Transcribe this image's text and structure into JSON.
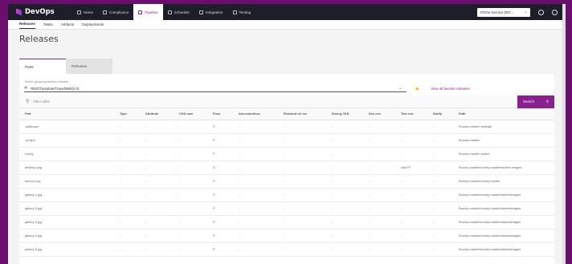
{
  "brand": {
    "name": "DevOps"
  },
  "topnav": {
    "tabs": [
      {
        "label": "Home",
        "active": false
      },
      {
        "label": "Compliance",
        "active": false
      },
      {
        "label": "Pipeline",
        "active": true
      },
      {
        "label": "Schedule",
        "active": false
      },
      {
        "label": "Integration",
        "active": false
      },
      {
        "label": "Testing",
        "active": false
      }
    ],
    "service_select": "POOe-Service (RO..."
  },
  "subnav": {
    "items": [
      {
        "label": "Releases",
        "active": true
      },
      {
        "label": "Tasks",
        "active": false
      },
      {
        "label": "Artifacts",
        "active": false
      },
      {
        "label": "Deployments",
        "active": false
      }
    ]
  },
  "page": {
    "title": "Releases"
  },
  "tabs": [
    {
      "label": "Parts",
      "active": true
    },
    {
      "label": "Releases",
      "active": false
    }
  ],
  "selector": {
    "label": "Select group/application/release",
    "value": "RDO/Translate/TravelWeb(2.0)",
    "view_all": "View all favorite releases"
  },
  "filter": {
    "placeholder": "Filter table",
    "search_label": "Search"
  },
  "table": {
    "columns": [
      "Part",
      "Type",
      "Attribute",
      "CKD user",
      "Envs",
      "Ancestor/desc",
      "Resident rel ver",
      "Emerg CKD",
      "Dev env",
      "Test env",
      "Notify",
      "Path"
    ],
    "rows": [
      [
        ".jsdtscope",
        "-",
        "-",
        "-",
        "P",
        "-",
        "-",
        "-",
        "-",
        "-",
        "-",
        "Bounty-master/.settings"
      ],
      [
        ".project",
        "-",
        "-",
        "-",
        "P",
        "-",
        "-",
        "-",
        "-",
        "-",
        "-",
        "Bounty-master/"
      ],
      [
        "config",
        "-",
        "-",
        "-",
        "P",
        "-",
        "-",
        "-",
        "-",
        "-",
        "-",
        "Bounty-master/.stdlive"
      ],
      [
        "desktop.png",
        "-",
        "-",
        "-",
        "D",
        "-",
        "-",
        "-",
        "-",
        "AN0YF",
        "-",
        "Bounty-master/bounty-master/seoline-images"
      ],
      [
        "favicon.svg",
        "-",
        "-",
        "-",
        "P",
        "-",
        "-",
        "-",
        "-",
        "-",
        "-",
        "Bounty-master/bounty-master"
      ],
      [
        "gallery-1.jpg",
        "-",
        "-",
        "-",
        "P",
        "-",
        "-",
        "-",
        "-",
        "-",
        "-",
        "Bounty-master/bounty-master/assets/images"
      ],
      [
        "gallery-2.jpg",
        "-",
        "-",
        "-",
        "P",
        "-",
        "-",
        "-",
        "-",
        "-",
        "-",
        "Bounty-master/bounty-master/assets/images"
      ],
      [
        "gallery-3.jpg",
        "-",
        "-",
        "-",
        "P",
        "-",
        "-",
        "-",
        "-",
        "-",
        "-",
        "Bounty-master/bounty-master/assets/images"
      ],
      [
        "gallery-4.jpg",
        "-",
        "-",
        "-",
        "P",
        "-",
        "-",
        "-",
        "-",
        "-",
        "-",
        "Bounty-master/bounty-master/assets/images"
      ],
      [
        "gallery-5.jpg",
        "-",
        "-",
        "-",
        "P",
        "-",
        "-",
        "-",
        "-",
        "-",
        "-",
        "Bounty-master/bounty-master/assets/images"
      ]
    ]
  },
  "colors": {
    "accent": "#8a1f8e",
    "topnav_bg": "#1e1e2a",
    "star": "#f2b300"
  }
}
